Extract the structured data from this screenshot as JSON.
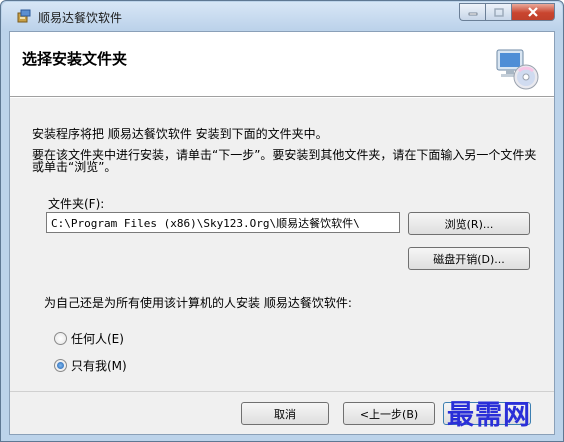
{
  "window": {
    "title": "顺易达餐饮软件"
  },
  "header": {
    "title": "选择安装文件夹",
    "graphic_icon": "computer-cd-icon"
  },
  "intro": {
    "line1": "安装程序将把 顺易达餐饮软件 安装到下面的文件夹中。",
    "line2": "要在该文件夹中进行安装，请单击“下一步”。要安装到其他文件夹，请在下面输入另一个文件夹或单击“浏览”。"
  },
  "folder": {
    "label": "文件夹(F):",
    "value": "C:\\Program Files (x86)\\Sky123.Org\\顺易达餐饮软件\\",
    "browse_label": "浏览(R)...",
    "disk_cost_label": "磁盘开销(D)..."
  },
  "install_for": {
    "prompt": "为自己还是为所有使用该计算机的人安装 顺易达餐饮软件:",
    "options": [
      {
        "label": "任何人(E)",
        "selected": false
      },
      {
        "label": "只有我(M)",
        "selected": true
      }
    ]
  },
  "buttons": {
    "cancel": "取消",
    "back": "<上一步(B)"
  },
  "watermark": "最需网"
}
